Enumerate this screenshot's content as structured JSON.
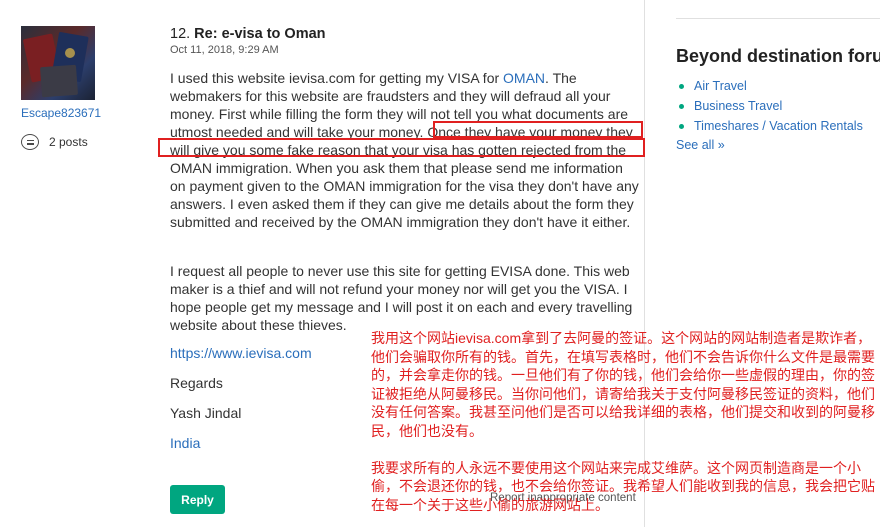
{
  "author": {
    "username": "Escape823671",
    "posts_label": "2 posts"
  },
  "post": {
    "number": "12.",
    "title": "Re: e-visa to Oman",
    "date": "Oct 11, 2018, 9:29 AM",
    "para1_part1": "I used this website ievisa.com for getting my VISA for ",
    "para1_link": "OMAN",
    "para1_part2": ". The webmakers for this website are fraudsters and they will defraud all your money. First while filling the form they will not tell you what documents are utmost needed and will take your money. Once they have your money they will give you some fake reason that your visa has gotten rejected from the OMAN immigration. When you ask them that please send me information on payment given to the OMAN immigration for the visa they don't have any answers. I even asked them if they can give me details about the form they submitted and received by the OMAN immigration they don't have it either.",
    "para2": "I request all people to never use this site for getting EVISA done. This web maker is a thief and will not refund your money nor will get you the VISA. I hope people get my message and I will post it on each and every travelling website about these thieves.",
    "url": "https://www.ievisa.com",
    "regards": "Regards",
    "signature": "Yash Jindal",
    "location": "India",
    "reply_label": "Reply",
    "report_label": "Report inappropriate content"
  },
  "annotation": {
    "highlight_color": "#e02020",
    "note_p1": "我用这个网站ievisa.com拿到了去阿曼的签证。这个网站的网站制造者是欺诈者，他们会骗取你所有的钱。首先，在填写表格时，他们不会告诉你什么文件是最需要的，并会拿走你的钱。一旦他们有了你的钱，他们会给你一些虚假的理由，你的签证被拒绝从阿曼移民。当你问他们，请寄给我关于支付阿曼移民签证的资料，他们没有任何答案。我甚至问他们是否可以给我详细的表格，他们提交和收到的阿曼移民，他们也没有。",
    "note_p2": "我要求所有的人永远不要使用这个网站来完成艾维萨。这个网页制造商是一个小偷，不会退还你的钱，也不会给你签证。我希望人们能收到我的信息，我会把它贴在每一个关于这些小偷的旅游网站上。"
  },
  "sidebar": {
    "title": "Beyond destination foru",
    "items": [
      "Air Travel",
      "Business Travel",
      "Timeshares / Vacation Rentals"
    ],
    "see_all": "See all »"
  },
  "colors": {
    "link": "#2a6ebb",
    "accent_green": "#00a680",
    "annotation_red": "#e02020"
  }
}
